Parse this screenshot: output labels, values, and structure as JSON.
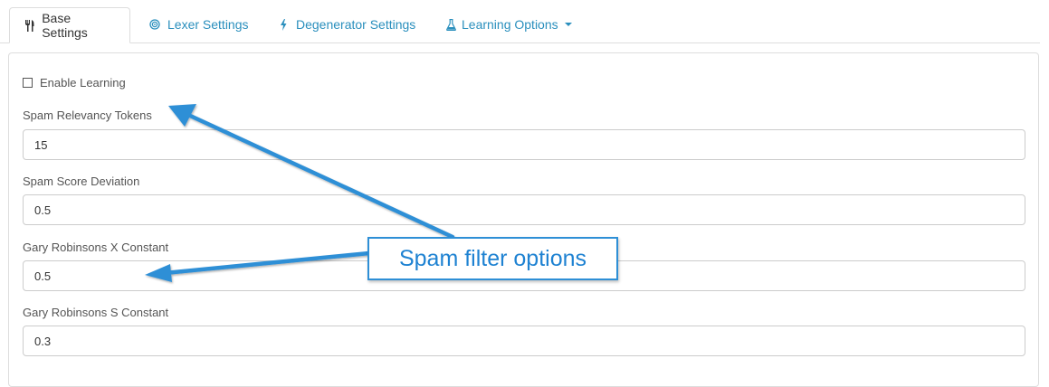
{
  "tabs": [
    {
      "label": "Base Settings",
      "icon": "cutlery-icon",
      "active": true
    },
    {
      "label": "Lexer Settings",
      "icon": "target-icon",
      "active": false
    },
    {
      "label": "Degenerator Settings",
      "icon": "bolt-icon",
      "active": false
    },
    {
      "label": "Learning Options",
      "icon": "flask-icon",
      "active": false,
      "dropdown": true
    }
  ],
  "form": {
    "enable_learning": {
      "label": "Enable Learning",
      "checked": false
    },
    "fields": [
      {
        "label": "Spam Relevancy Tokens",
        "value": "15"
      },
      {
        "label": "Spam Score Deviation",
        "value": "0.5"
      },
      {
        "label": "Gary Robinsons X Constant",
        "value": "0.5"
      },
      {
        "label": "Gary Robinsons S Constant",
        "value": "0.3"
      }
    ]
  },
  "annotation": {
    "text": "Spam filter options",
    "color": "#2e8fd6"
  },
  "colors": {
    "link": "#2a8fbd",
    "border": "#dddddd",
    "text": "#555555"
  }
}
